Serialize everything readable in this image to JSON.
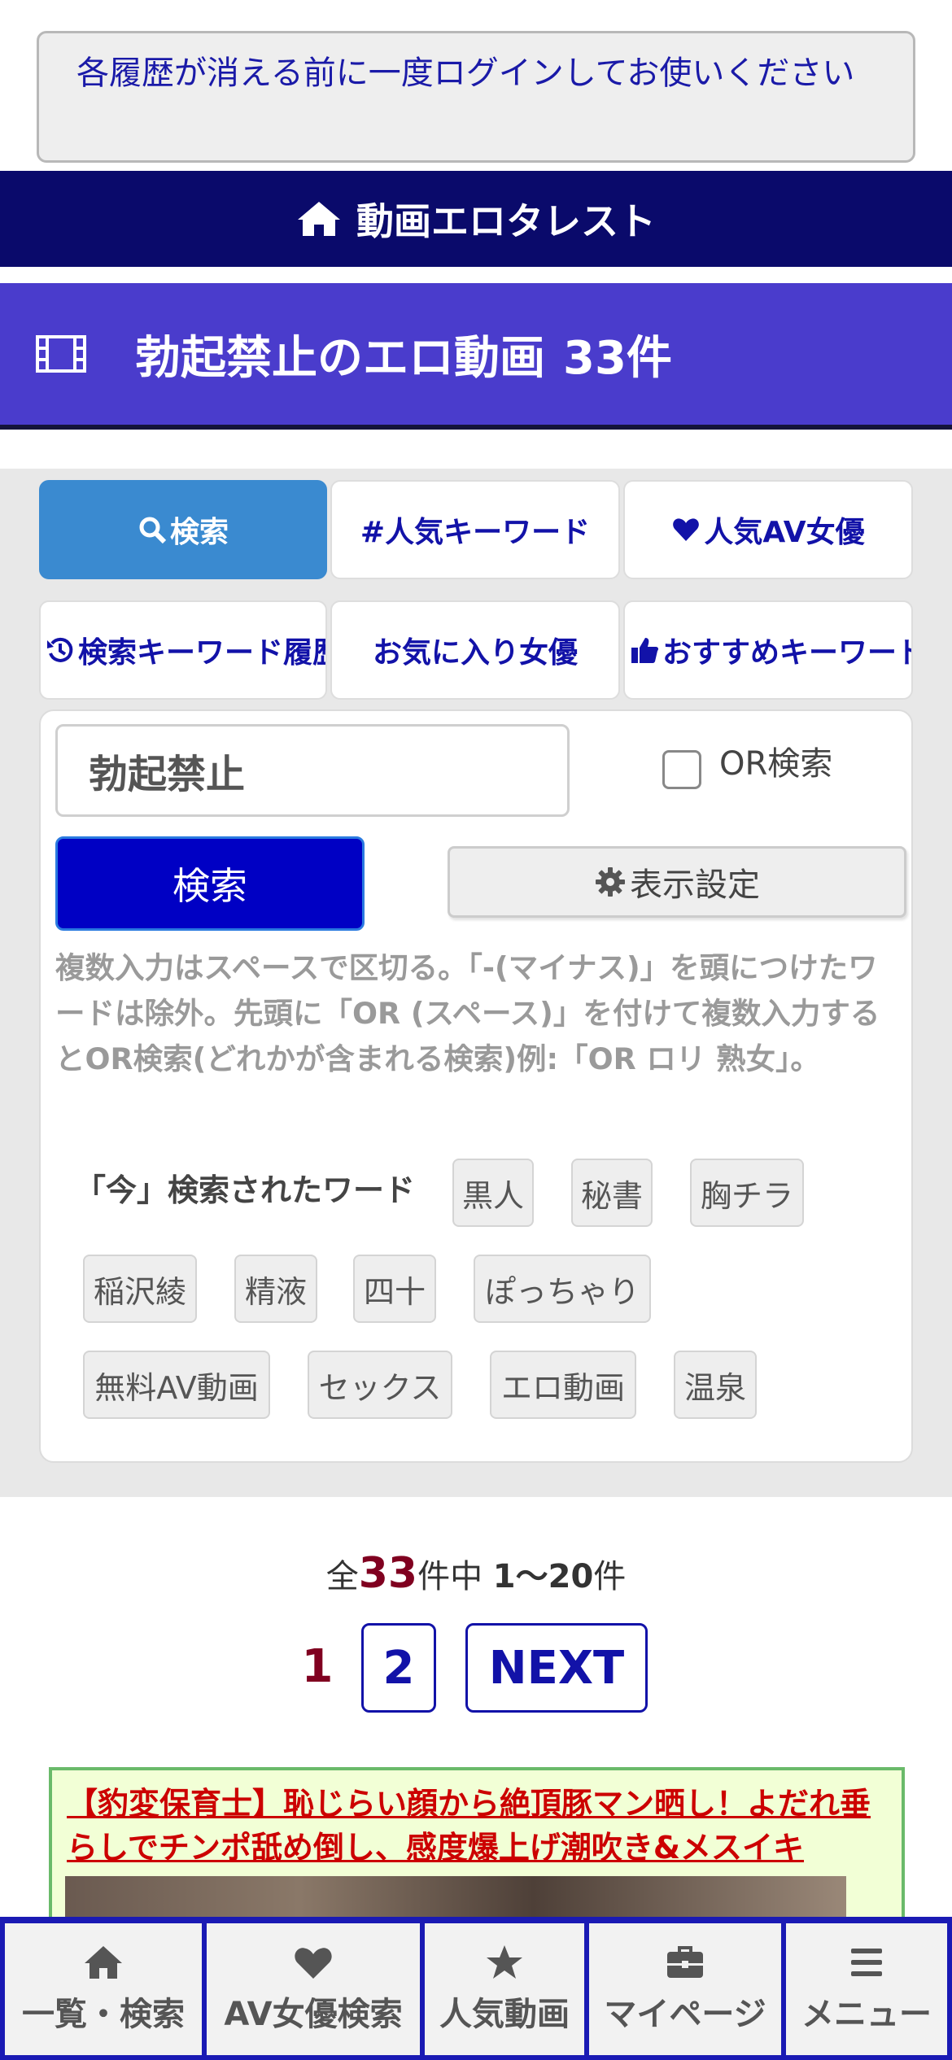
{
  "notice": "各履歴が消える前に一度ログインしてお使いください",
  "site_bar": {
    "title": "動画エロタレスト"
  },
  "page_title": {
    "keyword_title": "勃起禁止のエロ動画",
    "count_label": "33件"
  },
  "tabs": [
    {
      "label": "検索",
      "icon": "search-icon",
      "active": true
    },
    {
      "label": "#人気キーワード",
      "icon": "",
      "active": false
    },
    {
      "label": "人気AV女優",
      "icon": "heart-icon",
      "active": false
    },
    {
      "label": "検索キーワード履歴",
      "icon": "history-icon",
      "active": false
    },
    {
      "label": "お気に入り女優",
      "icon": "",
      "active": false
    },
    {
      "label": "おすすめキーワード",
      "icon": "thumbs-up-icon",
      "active": false
    }
  ],
  "search": {
    "value": "勃起禁止",
    "or_label": "OR検索",
    "or_checked": false,
    "button_label": "検索",
    "settings_label": "表示設定",
    "help": "複数入力はスペースで区切る。「-(マイナス)」を頭につけたワードは除外。先頭に「OR (スペース)」を付けて複数入力するとOR検索(どれかが含まれる検索)例:「OR ロリ 熟女」。"
  },
  "recent": {
    "label": "「今」検索されたワード",
    "words": [
      "黒人",
      "秘書",
      "胸チラ",
      "稲沢綾",
      "精液",
      "四十",
      "ぽっちゃり",
      "無料AV動画",
      "セックス",
      "エロ動画",
      "温泉"
    ]
  },
  "results": {
    "prefix": "全",
    "total": "33",
    "mid": "件中",
    "range": "1〜20",
    "suffix": "件"
  },
  "pager": {
    "current": "1",
    "page2": "2",
    "next": "NEXT"
  },
  "card": {
    "title": "【豹変保育士】恥じらい顔から絶頂豚マン晒し！よだれ垂らしでチンポ舐め倒し、感度爆上げ潮吹き&メスイキ"
  },
  "bottom_nav": [
    {
      "label": "一覧・検索",
      "icon": "home-icon"
    },
    {
      "label": "AV女優検索",
      "icon": "heart-icon"
    },
    {
      "label": "人気動画",
      "icon": "star-icon"
    },
    {
      "label": "マイページ",
      "icon": "briefcase-icon"
    },
    {
      "label": "メニュー",
      "icon": "menu-icon"
    }
  ],
  "colors": {
    "site_bar": "#0a0a6b",
    "title_bar": "#4a3ccc",
    "active_tab": "#3a8ad0",
    "search_button": "#0000c4",
    "accent_red": "#800020",
    "link_blue": "#1212a8"
  }
}
